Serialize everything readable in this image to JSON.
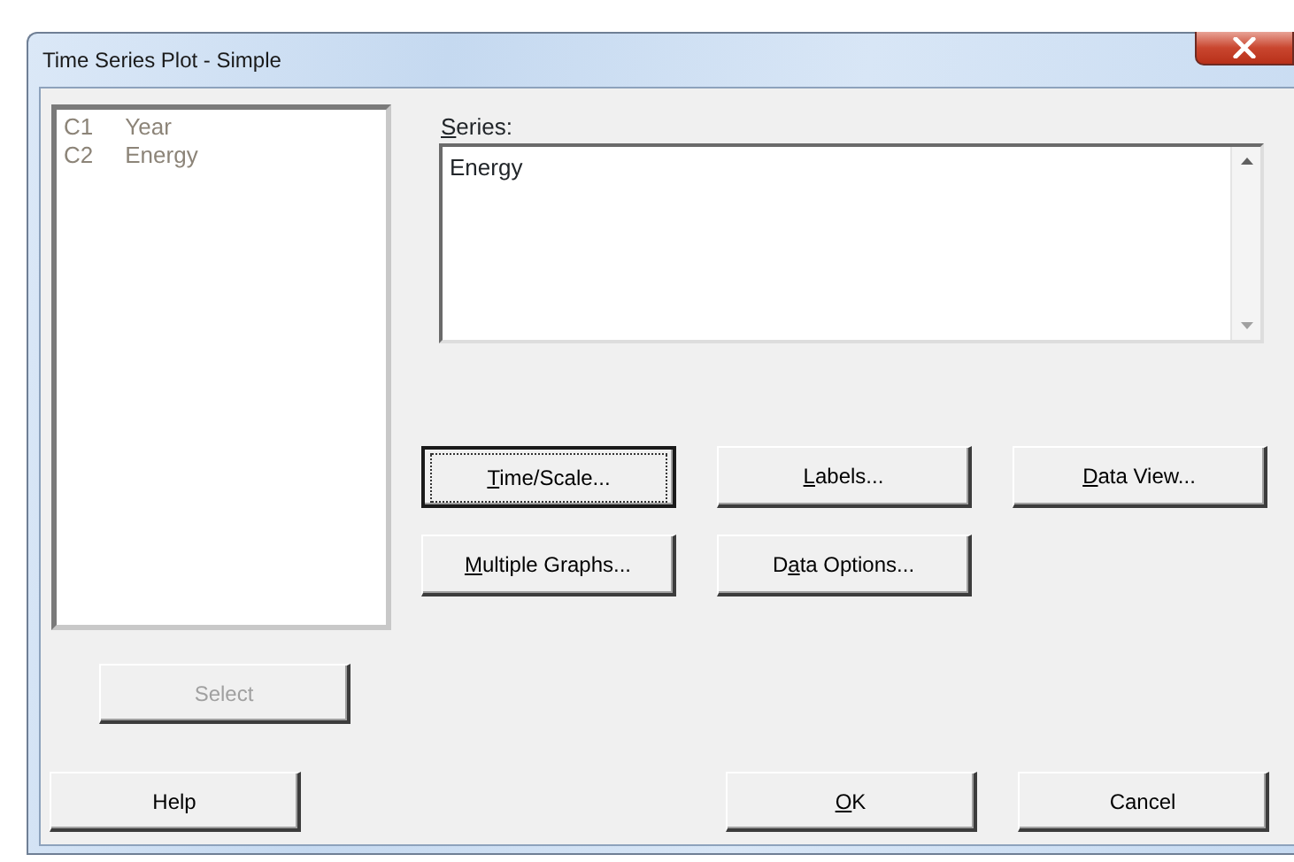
{
  "window": {
    "title": "Time Series Plot - Simple"
  },
  "columns": [
    {
      "number": "C1",
      "name": "Year"
    },
    {
      "number": "C2",
      "name": "Energy"
    }
  ],
  "series": {
    "label": {
      "key": "S",
      "post": "eries:"
    },
    "value": "Energy"
  },
  "option_buttons": [
    [
      {
        "key": "T",
        "post": "ime/Scale...",
        "focused": true
      },
      {
        "key": "L",
        "post": "abels...",
        "focused": false
      },
      {
        "key": "D",
        "post": "ata View...",
        "focused": false
      }
    ],
    [
      {
        "key": "M",
        "post": "ultiple Graphs...",
        "focused": false
      },
      {
        "pre": "D",
        "key": "a",
        "post": "ta Options...",
        "focused": false
      }
    ]
  ],
  "select_button": {
    "label": "Select",
    "disabled": true
  },
  "bottom_buttons": [
    {
      "kind": "help",
      "pre": "Help"
    },
    {
      "kind": "ok",
      "key": "O",
      "post": "K"
    },
    {
      "kind": "cancel",
      "pre": "Cancel"
    }
  ]
}
